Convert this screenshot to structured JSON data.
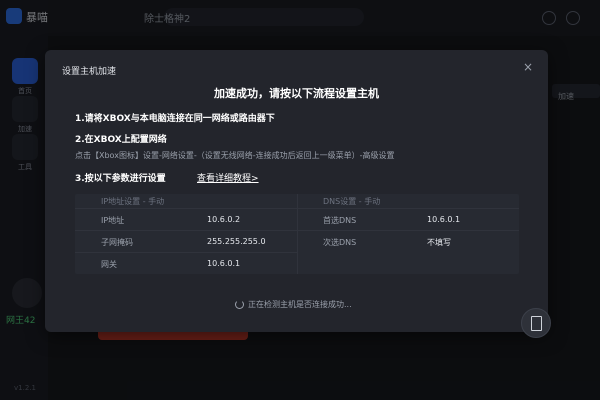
{
  "app": {
    "name": "暴喵",
    "search_text": "除士格神2",
    "side_items": [
      {
        "label": "首页"
      },
      {
        "label": "加速"
      },
      {
        "label": "工具"
      }
    ],
    "stat_text": "网王42",
    "version_text": "v1.2.1",
    "right_chip": "加速"
  },
  "dialog": {
    "title": "设置主机加速",
    "close_label": "×",
    "heading": "加速成功，请按以下流程设置主机",
    "step1": "1.请将XBOX与本电脑连接在同一网络或路由器下",
    "step2": "2.在XBOX上配置网络",
    "step2_desc": "点击【Xbox图标】设置-网络设置-（设置无线网络-连接成功后返回上一级菜单）-高级设置",
    "step3": "3.按以下参数进行设置",
    "step3_link": "查看详细教程>",
    "table": {
      "left_header": "IP地址设置 - 手动",
      "right_header": "DNS设置 - 手动",
      "left_rows": [
        {
          "label": "IP地址",
          "value": "10.6.0.2"
        },
        {
          "label": "子网掩码",
          "value": "255.255.255.0"
        },
        {
          "label": "网关",
          "value": "10.6.0.1"
        }
      ],
      "right_rows": [
        {
          "label": "首选DNS",
          "value": "10.6.0.1"
        },
        {
          "label": "次选DNS",
          "value": "不填写"
        }
      ]
    },
    "status": "正在检测主机是否连接成功..."
  },
  "icons": {
    "spinner": "loading-spinner-icon",
    "fab": "device-icon",
    "close": "close-icon"
  }
}
